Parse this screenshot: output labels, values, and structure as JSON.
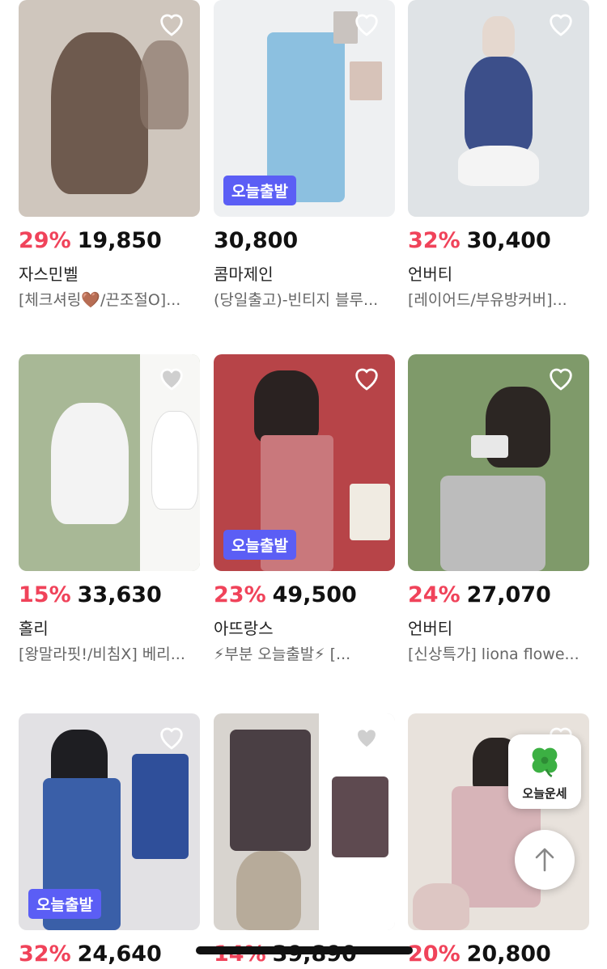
{
  "accent_discount_color": "#f0435a",
  "badge_color": "#5b5ef5",
  "products": [
    {
      "discount": "29%",
      "price": "19,850",
      "brand": "자스민벨",
      "desc": "[체크셔링🤎/끈조절O]...",
      "badge": "",
      "bg": "#cfc6bd",
      "fig": "#6e5a4e"
    },
    {
      "discount": "",
      "price": "30,800",
      "brand": "콤마제인",
      "desc": "(당일출고)-빈티지 블루...",
      "badge": "오늘출발",
      "bg": "#eef0f2",
      "fig": "#8cc0e0"
    },
    {
      "discount": "32%",
      "price": "30,400",
      "brand": "언버티",
      "desc": "[레이어드/부유방커버]...",
      "badge": "",
      "bg": "#dfe3e6",
      "fig": "#3c4f8a"
    },
    {
      "discount": "15%",
      "price": "33,630",
      "brand": "홀리",
      "desc": "[왕말라핏!/비침X] 베리...",
      "badge": "",
      "bg": "#a8b896",
      "fig": "#f3f3f3"
    },
    {
      "discount": "23%",
      "price": "49,500",
      "brand": "아뜨랑스",
      "desc": "⚡부분 오늘출발⚡ [...",
      "badge": "오늘출발",
      "bg": "#b74448",
      "fig": "#c9787c"
    },
    {
      "discount": "24%",
      "price": "27,070",
      "brand": "언버티",
      "desc": "[신상특가] liona flowe...",
      "badge": "",
      "bg": "#7f9a6a",
      "fig": "#bcbcbc"
    },
    {
      "discount": "32%",
      "price": "24,640",
      "brand": "",
      "desc": "",
      "badge": "오늘출발",
      "bg": "#e2e1e4",
      "fig": "#3a5fa8"
    },
    {
      "discount": "14%",
      "price": "39,890",
      "brand": "",
      "desc": "",
      "badge": "",
      "bg": "#d8d4cf",
      "fig": "#4a3f44"
    },
    {
      "discount": "20%",
      "price": "20,800",
      "brand": "",
      "desc": "",
      "badge": "",
      "bg": "#e8e2dc",
      "fig": "#d7b4b8"
    }
  ],
  "floating": {
    "fortune_label": "오늘운세",
    "clover_icon": "four-leaf-clover-icon",
    "top_icon": "arrow-up-icon"
  }
}
